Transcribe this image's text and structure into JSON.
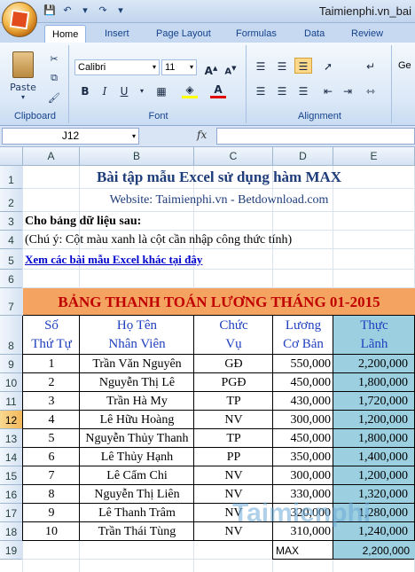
{
  "window": {
    "title": "Taimienphi.vn_bai"
  },
  "tabs": [
    "Home",
    "Insert",
    "Page Layout",
    "Formulas",
    "Data",
    "Review"
  ],
  "ribbon": {
    "clipboard": {
      "label": "Clipboard",
      "paste": "Paste"
    },
    "font": {
      "label": "Font",
      "name": "Calibri",
      "size": "11",
      "bold": "B",
      "italic": "I",
      "underline": "U"
    },
    "alignment": {
      "label": "Alignment"
    },
    "more": "Ge"
  },
  "formula_bar": {
    "name_box": "J12",
    "fx": "fx",
    "formula": ""
  },
  "columns": [
    "A",
    "B",
    "C",
    "D",
    "E"
  ],
  "rows": [
    "1",
    "2",
    "3",
    "4",
    "5",
    "6",
    "7",
    "8",
    "9",
    "10",
    "11",
    "12",
    "13",
    "14",
    "15",
    "16",
    "17",
    "18",
    "19"
  ],
  "selected_row": "12",
  "sheet": {
    "title": "Bài tập mẫu Excel sử dụng hàm MAX",
    "website": "Website: Taimienphi.vn - Betdownload.com",
    "given": "Cho bảng dữ liệu sau:",
    "note": "(Chú ý: Cột màu xanh là cột cần nhập công thức tính)",
    "link": "Xem các bài mẫu Excel khác tại đây",
    "table_title": "BẢNG THANH TOÁN LƯƠNG THÁNG 01-2015",
    "headers": {
      "stt": [
        "Số",
        "Thứ Tự"
      ],
      "name": [
        "Họ Tên",
        "Nhân Viên"
      ],
      "role": [
        "Chức",
        "Vụ"
      ],
      "base": [
        "Lương",
        "Cơ Bản"
      ],
      "net": [
        "Thực",
        "Lãnh"
      ]
    },
    "data": [
      {
        "stt": "1",
        "name": "Trần Văn Nguyên",
        "role": "GĐ",
        "base": "550,000",
        "net": "2,200,000"
      },
      {
        "stt": "2",
        "name": "Nguyễn Thị Lê",
        "role": "PGĐ",
        "base": "450,000",
        "net": "1,800,000"
      },
      {
        "stt": "3",
        "name": "Trần Hà My",
        "role": "TP",
        "base": "430,000",
        "net": "1,720,000"
      },
      {
        "stt": "4",
        "name": "Lê Hữu Hoàng",
        "role": "NV",
        "base": "300,000",
        "net": "1,200,000"
      },
      {
        "stt": "5",
        "name": "Nguyễn Thủy Thanh",
        "role": "TP",
        "base": "450,000",
        "net": "1,800,000"
      },
      {
        "stt": "6",
        "name": "Lê Thủy Hạnh",
        "role": "PP",
        "base": "350,000",
        "net": "1,400,000"
      },
      {
        "stt": "7",
        "name": "Lê Cẩm Chi",
        "role": "NV",
        "base": "300,000",
        "net": "1,200,000"
      },
      {
        "stt": "8",
        "name": "Nguyễn Thị Liên",
        "role": "NV",
        "base": "330,000",
        "net": "1,320,000"
      },
      {
        "stt": "9",
        "name": "Lê Thanh Trâm",
        "role": "NV",
        "base": "320,000",
        "net": "1,280,000"
      },
      {
        "stt": "10",
        "name": "Trần Thái Tùng",
        "role": "NV",
        "base": "310,000",
        "net": "1,240,000"
      }
    ],
    "max_label": "MAX",
    "max_value": "2,200,000"
  },
  "watermark": "Taimienphi",
  "colors": {
    "title_blue": "#1f3d7a",
    "band_orange": "#f4a460",
    "band_text": "#c00000",
    "header_blue": "#1f3fbf",
    "net_fill": "#9ccfe0"
  }
}
